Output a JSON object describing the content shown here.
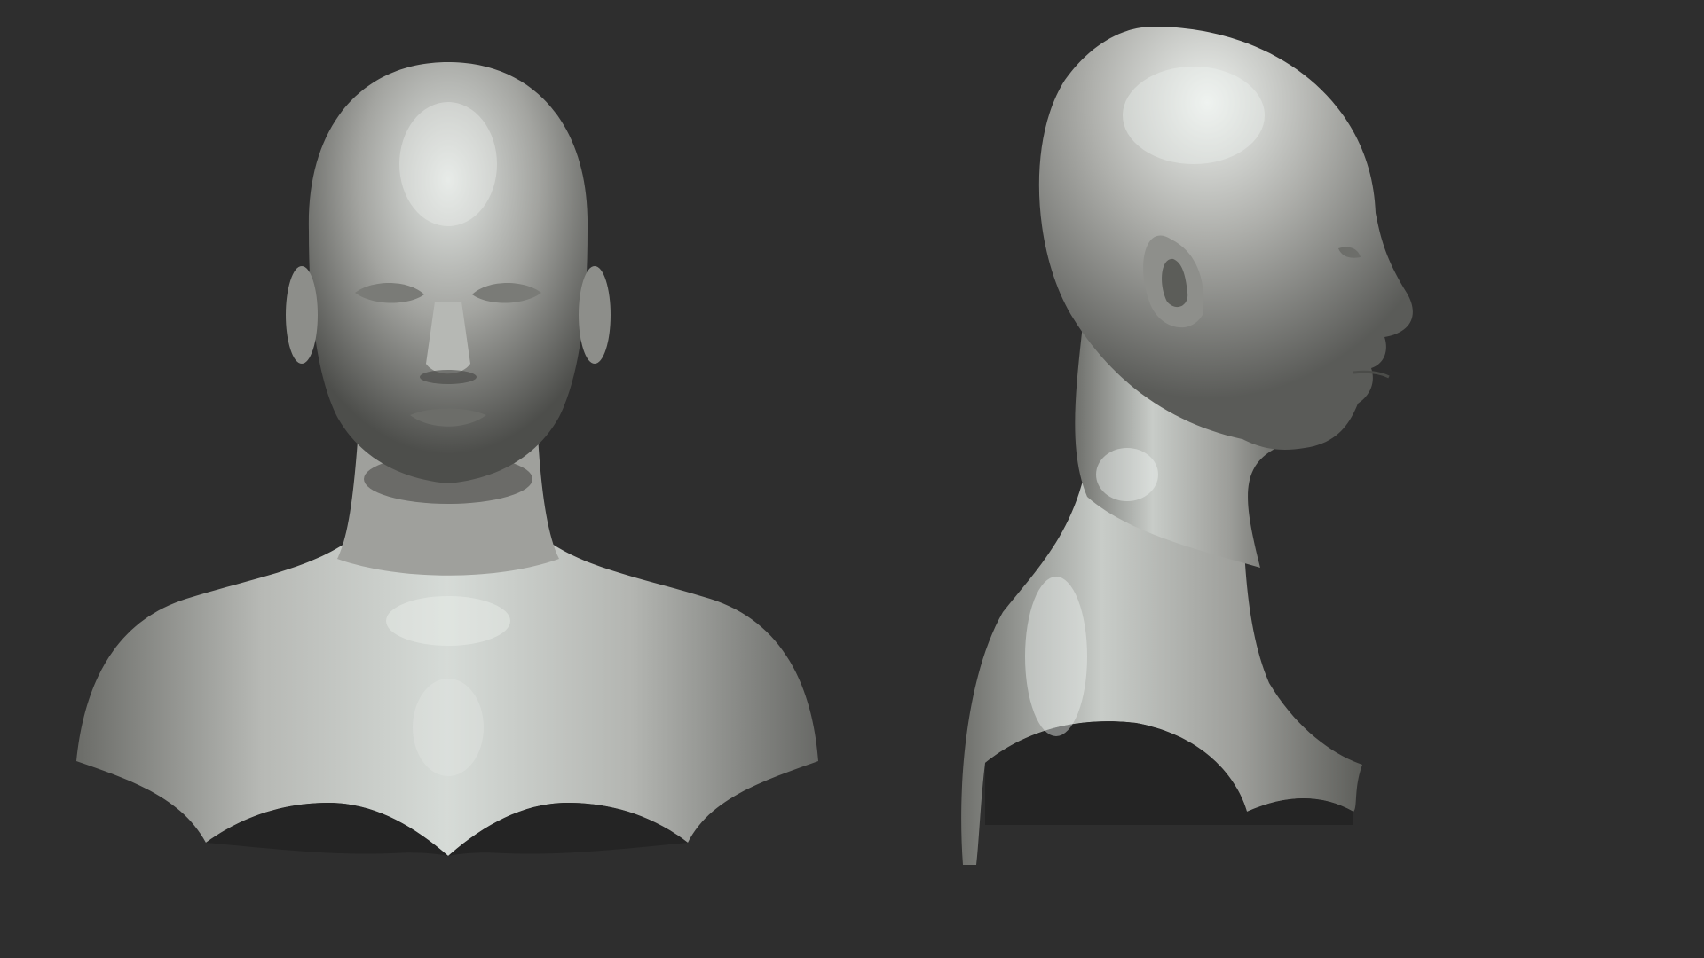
{
  "scene": {
    "background_color": "#2e2e2e",
    "clay_color": "#a9aaa6",
    "highlight_color": "#e7ece9",
    "shadow_color": "#3a3b3a",
    "views": [
      {
        "name": "front-view",
        "description": ""
      },
      {
        "name": "side-view",
        "description": ""
      }
    ]
  }
}
